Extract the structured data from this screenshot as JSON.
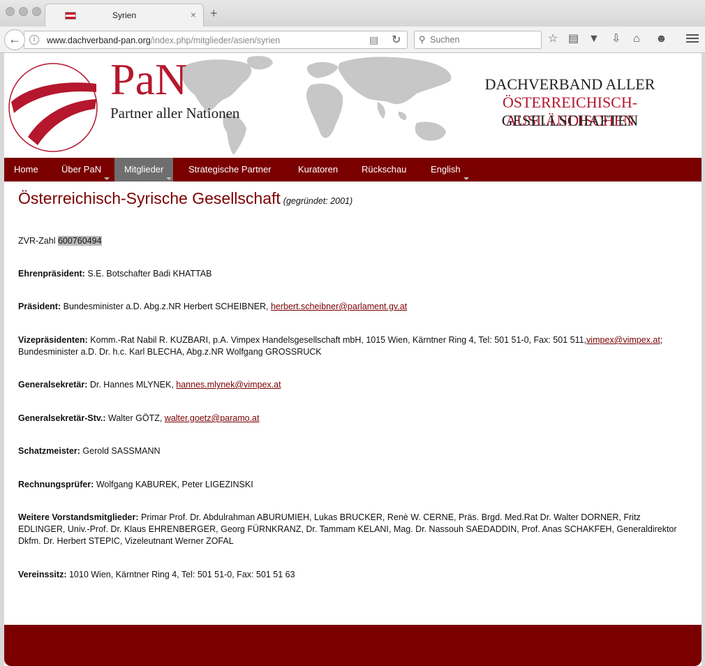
{
  "browser": {
    "tab_title": "Syrien",
    "tab_close": "×",
    "new_tab": "+",
    "url_host": "www.dachverband-pan.org",
    "url_path": "/index.php/mitglieder/asien/syrien",
    "search_placeholder": "Suchen"
  },
  "banner": {
    "logo_text": "PaN",
    "logo_subtitle": "Partner aller Nationen",
    "slogan_line1": "DACHVERBAND ALLER",
    "slogan_line2": "ÖSTERREICHISCH-AUSLÄNDISCHEN",
    "slogan_line3": "GESELLSCHAFTEN"
  },
  "nav": [
    {
      "label": "Home"
    },
    {
      "label": "Über PaN"
    },
    {
      "label": "Mitglieder"
    },
    {
      "label": "Strategische Partner"
    },
    {
      "label": "Kuratoren"
    },
    {
      "label": "Rückschau"
    },
    {
      "label": "English"
    }
  ],
  "content": {
    "title": "Österreichisch-Syrische Gesellschaft",
    "title_sub": "(gegründet: 2001)",
    "zvr_label": "ZVR-Zahl",
    "zvr_number": "600760494",
    "ehren_label": "Ehrenpräsident:",
    "ehren_text": " S.E. Botschafter Badi KHATTAB",
    "praes_label": "Präsident:",
    "praes_text": " Bundesminister a.D. Abg.z.NR Herbert SCHEIBNER, ",
    "praes_email": "herbert.scheibner@parlament.gv.at",
    "vize_label": "Vizepräsidenten:",
    "vize_text1": " Komm.-Rat Nabil R. KUZBARI, p.A. Vimpex Handelsgesellschaft mbH, 1015 Wien, Kärntner Ring 4, Tel: 501 51-0, Fax: 501 511,",
    "vize_email": "vimpex@vimpex.at",
    "vize_text2": "; Bundesminister a.D. Dr. h.c. Karl BLECHA, Abg.z.NR Wolfgang GROSSRUCK",
    "gensek_label": "Generalsekretär:",
    "gensek_text": " Dr. Hannes MLYNEK, ",
    "gensek_email": "hannes.mlynek@vimpex.at",
    "gensekstv_label": "Generalsekretär-Stv.:",
    "gensekstv_text": " Walter GÖTZ, ",
    "gensekstv_email": "walter.goetz@paramo.at",
    "schatz_label": "Schatzmeister:",
    "schatz_text": " Gerold SASSMANN",
    "rech_label": "Rechnungsprüfer:",
    "rech_text": " Wolfgang KABUREK, Peter LIGEZINSKI",
    "weitere_label": "Weitere Vorstandsmitglieder:",
    "weitere_text": " Primar Prof. Dr. Abdulrahman ABURUMIEH, Lukas BRUCKER, Renè W. CERNE, Präs. Brgd. Med.Rat Dr. Walter DORNER, Fritz EDLINGER, Univ.-Prof. Dr. Klaus EHRENBERGER, Georg FÜRNKRANZ, Dr. Tammam KELANI, Mag. Dr. Nassouh SAEDADDIN, Prof. Anas SCHAKFEH, Generaldirektor Dkfm. Dr. Herbert STEPIC, Vizeleutnant Werner ZOFAL",
    "sitz_label": "Vereinssitz:",
    "sitz_text": " 1010 Wien, Kärntner Ring 4, Tel: 501 51-0, Fax: 501 51 63"
  },
  "colors": {
    "brand_red": "#b5172e",
    "nav_bg": "#7a0000",
    "nav_active": "#6e6e6e"
  }
}
